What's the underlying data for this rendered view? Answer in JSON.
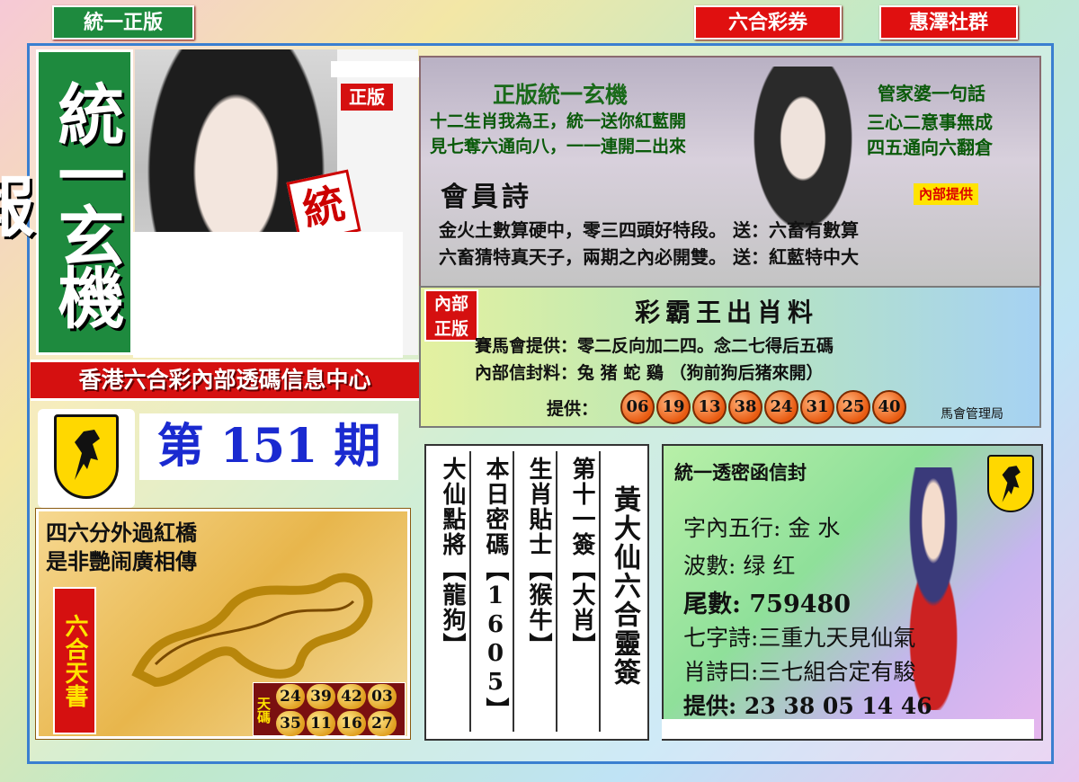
{
  "top_tags": {
    "left": "統一正版",
    "mid": "六合彩券",
    "right": "惠澤社群"
  },
  "masthead": {
    "title": "統一玄機報",
    "stamp_badge": "正版",
    "seal_char": "統"
  },
  "banner": "香港六合彩內部透碼信息中心",
  "issue": "第 151 期",
  "top_panel": {
    "title": "正版統一玄機",
    "line1": "十二生肖我為王，統一送你紅藍開",
    "line2": "見七奪六通向八，一一連開二出來",
    "right_title": "管家婆一句話",
    "right_line1": "三心二意事無成",
    "right_line2": "四五通向六翻倉",
    "poem_title": "會員詩",
    "poem_badge": "內部提供",
    "poem_line1": "金火土數算硬中，零三四頭好特段。 送：六畜有數算",
    "poem_line2": "六畜猜特真天子，兩期之內必開雙。 送：紅藍特中大"
  },
  "mid_panel": {
    "badge_top": "內部",
    "badge_bottom": "正版",
    "title": "彩霸王出肖料",
    "line1": "賽馬會提供：零二反向加二四。念二七得后五碼",
    "line2": "內部信封料：兔 猪 蛇 鷄 （狗前狗后猪來開）",
    "provide_label": "提供：",
    "numbers": [
      "06",
      "19",
      "13",
      "38",
      "24",
      "31",
      "25",
      "40"
    ],
    "footer": "馬會管理局"
  },
  "dragon_panel": {
    "verse1": "四六分外過紅橋",
    "verse2": "是非艷闹廣相傳",
    "side_title": "六合天書",
    "code_label": "天碼",
    "row1": [
      "24",
      "39",
      "42",
      "03"
    ],
    "row2": [
      "35",
      "11",
      "16",
      "27"
    ]
  },
  "columns": {
    "col1": "大仙點將【龍狗】",
    "col2": "本日密碼【1605】",
    "col3": "生肖貼士【猴牛】",
    "col4": "第十一簽【大肖】",
    "col5": "黃大仙六合靈簽"
  },
  "envelope": {
    "title": "統一透密函信封",
    "row1": "字內五行: 金 水",
    "row2": "波數: 绿 红",
    "row3": "尾數: 759480",
    "row4": "七字詩:三重九天見仙氣",
    "row5": "肖詩曰:三七組合定有駿",
    "row6": "提供: 23 38 05 14 46"
  },
  "colors": {
    "red": "#e01010",
    "green": "#1e8a3e",
    "blue": "#1a2ad0",
    "frame": "#3a7fd0",
    "gold": "#e0a020"
  },
  "icons": [
    "ferrari-horse-icon",
    "dragon-icon",
    "woman-photo",
    "anime-girl-image"
  ]
}
